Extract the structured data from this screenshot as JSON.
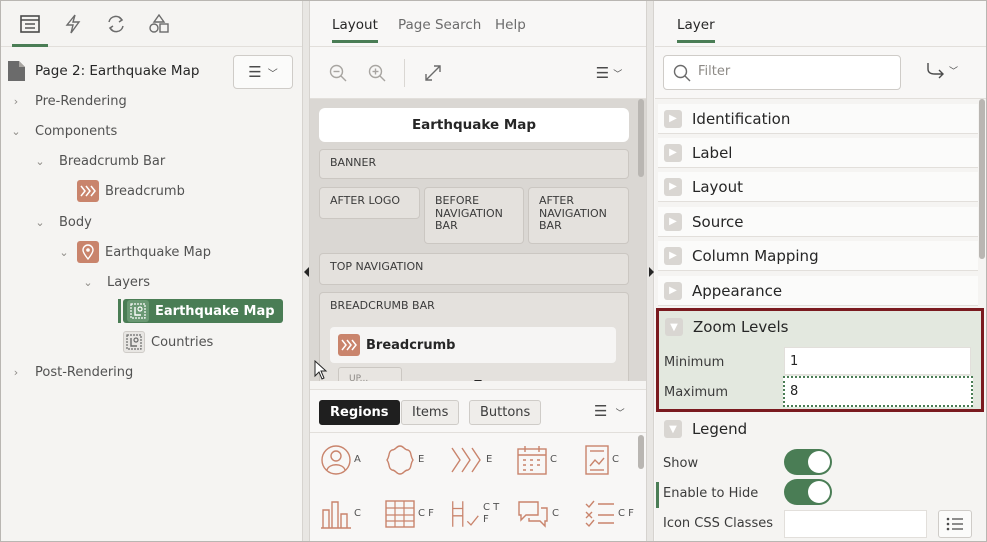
{
  "left": {
    "tab_icons": [
      "rendering-tree-icon",
      "dynamic-actions-icon",
      "processing-icon",
      "shared-components-icon"
    ],
    "page_title": "Page 2: Earthquake Map",
    "tree": {
      "pre_rendering": "Pre-Rendering",
      "components": "Components",
      "breadcrumb_bar": "Breadcrumb Bar",
      "breadcrumb": "Breadcrumb",
      "body": "Body",
      "earthquake_map": "Earthquake Map",
      "layers": "Layers",
      "layer_earthquake_map": "Earthquake Map",
      "layer_countries": "Countries",
      "post_rendering": "Post-Rendering"
    }
  },
  "middle": {
    "tabs": [
      "Layout",
      "Page Search",
      "Help"
    ],
    "canvas": {
      "title": "Earthquake Map",
      "banner": "BANNER",
      "after_logo": "AFTER LOGO",
      "before_nav_bar": "BEFORE NAVIGATION BAR",
      "after_nav_bar": "AFTER NAVIGATION BAR",
      "top_navigation": "TOP NAVIGATION",
      "breadcrumb_bar": "BREADCRUMB BAR",
      "breadcrumb_region": "Breadcrumb",
      "partial_slot": "UP..."
    },
    "gallery_tabs": [
      "Regions",
      "Items",
      "Buttons"
    ],
    "gallery_labels": [
      "A",
      "E",
      "E",
      "C",
      "C",
      "C",
      "C F",
      "C T F",
      "C",
      "C F"
    ]
  },
  "right": {
    "tab": "Layer",
    "filter_placeholder": "Filter",
    "sections": [
      "Identification",
      "Label",
      "Layout",
      "Source",
      "Column Mapping",
      "Appearance",
      "Zoom Levels",
      "Legend"
    ],
    "zoom": {
      "minimum_label": "Minimum",
      "minimum_value": "1",
      "maximum_label": "Maximum",
      "maximum_value": "8"
    },
    "legend": {
      "show_label": "Show",
      "enable_to_hide_label": "Enable to Hide",
      "icon_css_label": "Icon CSS Classes"
    },
    "colors": {
      "accent_green": "#4a7d55",
      "highlight_red": "#7a1a1f",
      "icon_orange": "#c9846c"
    }
  }
}
